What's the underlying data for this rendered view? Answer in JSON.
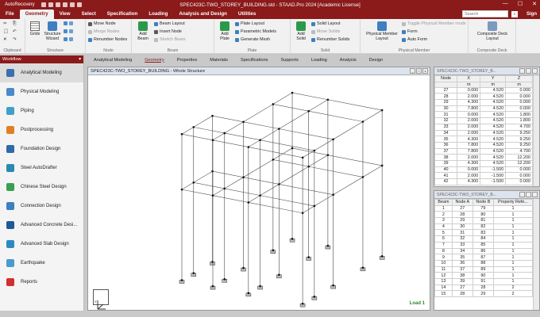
{
  "titlebar": {
    "autorecovery": "AutoRecovery",
    "title": "SPEC423C-TWO_STOREY_BUILDING.std - STAAD.Pro 2024 [Academic License]",
    "minimize": "—",
    "maximize": "☐",
    "close": "✕"
  },
  "menu": {
    "items": [
      "File",
      "Geometry",
      "View",
      "Select",
      "Specification",
      "Loading",
      "Analysis and Design",
      "Utilities"
    ],
    "active": "Geometry",
    "search_placeholder": "Search",
    "sign_in": "Sign"
  },
  "ribbon": {
    "clipboard": {
      "label": "Clipboard"
    },
    "structure": {
      "label": "Structure",
      "grids": "Grids",
      "wizard": "Structure Wizard"
    },
    "node": {
      "label": "Node",
      "move": "Move Node",
      "merge": "Merge Nodes",
      "renumber": "Renumber Nodes"
    },
    "beam": {
      "label": "Beam",
      "add": "Add Beam",
      "layout": "Beam Layout",
      "insert": "Insert Node",
      "stretch": "Stretch Beam"
    },
    "plate": {
      "label": "Plate",
      "add": "Add Plate",
      "layout": "Plate Layout",
      "param": "Parametric Models",
      "mesh": "Generate Mesh"
    },
    "solid": {
      "label": "Solid",
      "add": "Add Solid",
      "layout": "Solid Layout",
      "move": "Move Solids",
      "renumber": "Renumber Solids"
    },
    "physical": {
      "label": "Physical Member",
      "layout": "Physical Member Layout",
      "toggle": "Toggle Physical Member mode",
      "form": "Form",
      "autoform": "Auto Form"
    },
    "composite": {
      "label": "Composite Deck",
      "layout": "Composite Deck Layout"
    }
  },
  "subtabs": [
    "Analytical Modeling",
    "Geometry",
    "Properties",
    "Materials",
    "Specifications",
    "Supports",
    "Loading",
    "Analysis",
    "Design"
  ],
  "subtab_active": "Geometry",
  "workflow": {
    "title": "Workflow",
    "items": [
      {
        "label": "Analytical Modeling",
        "color": "#3a6fb0",
        "selected": true
      },
      {
        "label": "Physical Modeling",
        "color": "#4a8ac8",
        "selected": false
      },
      {
        "label": "Piping",
        "color": "#3fa0c8",
        "selected": false
      },
      {
        "label": "Postprocessing",
        "color": "#e08020",
        "selected": false
      },
      {
        "label": "Foundation Design",
        "color": "#2f6aa8",
        "selected": false
      },
      {
        "label": "Steel AutoDrafter",
        "color": "#2a8ab0",
        "selected": false
      },
      {
        "label": "Chinese Steel Design",
        "color": "#3aa050",
        "selected": false
      },
      {
        "label": "Connection Design",
        "color": "#3d7fc0",
        "selected": false
      },
      {
        "label": "Advanced Concrete Desi...",
        "color": "#1f5a98",
        "selected": false
      },
      {
        "label": "Advanced Slab Design",
        "color": "#2d8ac0",
        "selected": false
      },
      {
        "label": "Earthquake",
        "color": "#4a9ad0",
        "selected": false
      },
      {
        "label": "Reports",
        "color": "#d03030",
        "selected": false
      }
    ]
  },
  "view": {
    "title": "SPEC423C-TWO_STOREY_BUILDING - Whole Structure",
    "load": "Load 1"
  },
  "nodes_table": {
    "title": "SPEC423C-TWO_STOREY_B...",
    "headers": [
      "Node",
      "X",
      "Y",
      "Z"
    ],
    "units": [
      "",
      "m",
      "m",
      "m"
    ],
    "rows": [
      [
        "27",
        "0.000",
        "4.520",
        "0.000"
      ],
      [
        "28",
        "2.000",
        "4.520",
        "0.000"
      ],
      [
        "29",
        "4.300",
        "4.520",
        "0.000"
      ],
      [
        "30",
        "7.800",
        "4.520",
        "0.000"
      ],
      [
        "31",
        "0.000",
        "4.520",
        "1.800"
      ],
      [
        "32",
        "2.000",
        "4.520",
        "1.800"
      ],
      [
        "33",
        "2.000",
        "4.520",
        "4.700"
      ],
      [
        "34",
        "2.000",
        "4.520",
        "9.250"
      ],
      [
        "35",
        "4.300",
        "4.520",
        "9.250"
      ],
      [
        "36",
        "7.800",
        "4.520",
        "9.250"
      ],
      [
        "37",
        "7.800",
        "4.520",
        "4.700"
      ],
      [
        "38",
        "2.000",
        "4.520",
        "12.200"
      ],
      [
        "39",
        "4.300",
        "4.520",
        "12.200"
      ],
      [
        "40",
        "0.000",
        "-1.500",
        "0.000"
      ],
      [
        "41",
        "2.000",
        "-1.500",
        "0.000"
      ],
      [
        "42",
        "4.300",
        "-1.500",
        "0.000"
      ]
    ]
  },
  "beams_table": {
    "title": "SPEC423C-TWO_STOREY_B...",
    "headers": [
      "Beam",
      "Node A",
      "Node B",
      "Property Refe..."
    ],
    "rows": [
      [
        "1",
        "27",
        "79",
        "1"
      ],
      [
        "2",
        "28",
        "80",
        "1"
      ],
      [
        "3",
        "29",
        "81",
        "1"
      ],
      [
        "4",
        "30",
        "82",
        "1"
      ],
      [
        "5",
        "31",
        "83",
        "1"
      ],
      [
        "6",
        "32",
        "84",
        "1"
      ],
      [
        "7",
        "33",
        "85",
        "1"
      ],
      [
        "8",
        "34",
        "86",
        "1"
      ],
      [
        "9",
        "35",
        "87",
        "1"
      ],
      [
        "10",
        "36",
        "88",
        "1"
      ],
      [
        "11",
        "37",
        "89",
        "1"
      ],
      [
        "12",
        "38",
        "90",
        "1"
      ],
      [
        "13",
        "39",
        "91",
        "1"
      ],
      [
        "14",
        "27",
        "28",
        "2"
      ],
      [
        "15",
        "28",
        "29",
        "2"
      ]
    ]
  }
}
